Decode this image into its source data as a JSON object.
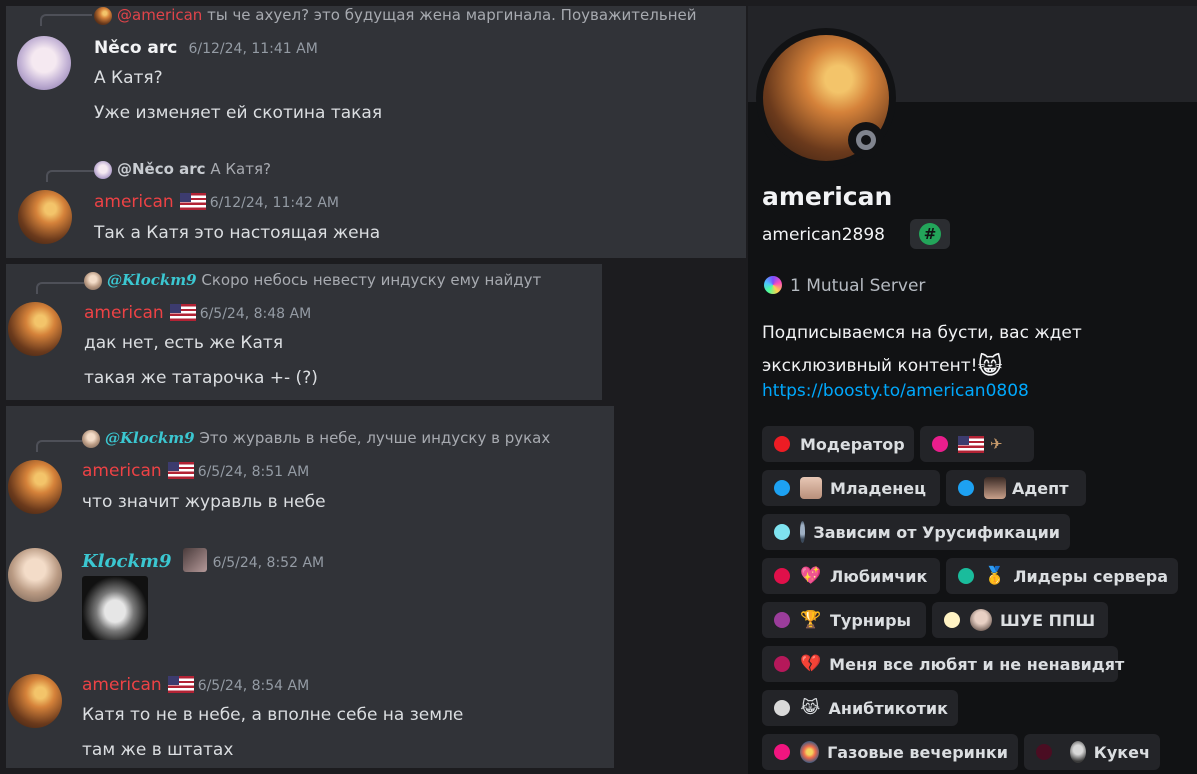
{
  "chat": {
    "top_reply": {
      "mention": "@american",
      "text": "ты че ахуел? это будущая жена маргинала. Поуважительней"
    },
    "msg1": {
      "author": "Něco arc",
      "timestamp": "6/12/24, 11:41 AM",
      "lines": [
        "А Катя?",
        "Уже изменяет ей скотина такая"
      ]
    },
    "reply2": {
      "author": "@Něco arc",
      "text": "А Катя?"
    },
    "msg2": {
      "author": "american",
      "timestamp": "6/12/24, 11:42 AM",
      "text": "Так а Катя это настоящая жена"
    },
    "reply3": {
      "author": "@𝑲𝒍𝒐𝒄𝒌𝒎9",
      "text": "Скоро небось невесту индуску ему найдут"
    },
    "msg3": {
      "author": "american",
      "timestamp": "6/5/24, 8:48 AM",
      "lines": [
        "дак нет, есть же Катя",
        "такая же татарочка +- (?)"
      ]
    },
    "reply4": {
      "author": "@𝑲𝒍𝒐𝒄𝒌𝒎9",
      "text": "Это журавль в небе,  лучше индуску в руках"
    },
    "msg4": {
      "author": "american",
      "timestamp": "6/5/24, 8:51 AM",
      "text": "что значит журавль в небе"
    },
    "msg5": {
      "author": "𝑲𝒍𝒐𝒄𝒌𝒎9",
      "timestamp": "6/5/24, 8:52 AM"
    },
    "msg6": {
      "author": "american",
      "timestamp": "6/5/24, 8:54 AM",
      "lines": [
        "Катя то не в небе, а вполне себе на земле",
        "там же в штатах"
      ]
    }
  },
  "profile": {
    "display_name": "american",
    "username": "american2898",
    "badge_icon": "hashtag-badge-icon",
    "mutual_servers": "1 Mutual Server",
    "bio_line1": "Подписываемся на бусти, вас ждет",
    "bio_line2": "эксклюзивный контент!",
    "bio_emoji": "😸",
    "link": "https://boosty.to/american0808",
    "roles": [
      {
        "label": "Модератор",
        "color": "#ed1c24",
        "emoji": ""
      },
      {
        "label": "",
        "color": "#e91e8c",
        "emoji": ""
      },
      {
        "label": "Младенец",
        "color": "#1da1f2",
        "emoji": ""
      },
      {
        "label": "Адепт",
        "color": "#1da1f2",
        "emoji": ""
      },
      {
        "label": "Зависим от Урусификации",
        "color": "#7fe3f0",
        "emoji": ""
      },
      {
        "label": "Любимчик",
        "color": "#e0104a",
        "emoji": "💖"
      },
      {
        "label": "Лидеры сервера",
        "color": "#1abc9c",
        "emoji": "🥇"
      },
      {
        "label": "Турниры",
        "color": "#9b3d9b",
        "emoji": "🏆"
      },
      {
        "label": "ШУЕ ППШ",
        "color": "#fff3c4",
        "emoji": ""
      },
      {
        "label": "Меня все любят и не ненавидят",
        "color": "#b5185a",
        "emoji": "💔"
      },
      {
        "label": "Анибтикотик",
        "color": "#d9d9d9",
        "emoji": "😹"
      },
      {
        "label": "Газовые вечеринки",
        "color": "#f0157f",
        "emoji": ""
      },
      {
        "label": "Кукеч",
        "color": "#4a0d22",
        "emoji": ""
      }
    ]
  },
  "colors": {
    "accent_link": "#00a8fc",
    "mention_red": "#ed4245",
    "teal_name": "#3bc7d1"
  }
}
